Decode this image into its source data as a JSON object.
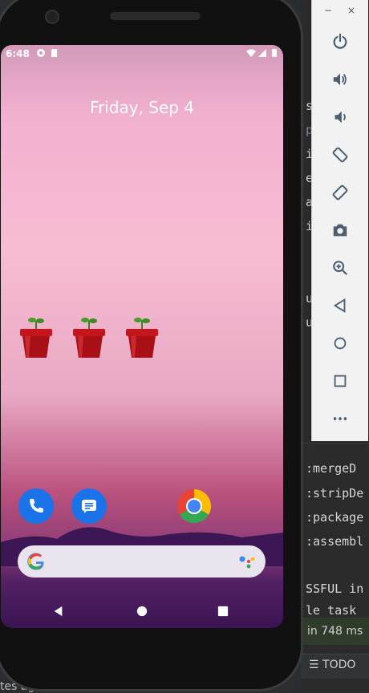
{
  "phone": {
    "status_bar": {
      "time": "6:48"
    },
    "date": "Friday, Sep 4",
    "home_icons": [
      {
        "name": "pot-plant-1"
      },
      {
        "name": "pot-plant-2"
      },
      {
        "name": "pot-plant-3"
      }
    ],
    "dock": [
      {
        "name": "phone-app",
        "color": "#1a73e8"
      },
      {
        "name": "messages-app",
        "color": "#1a73e8"
      },
      {
        "name": "chrome-app",
        "color": "#ea4335"
      }
    ]
  },
  "emulator_toolbar": {
    "minimize": "−",
    "close": "×",
    "buttons": [
      "power-icon",
      "volume-up-icon",
      "volume-down-icon",
      "rotate-left-icon",
      "rotate-right-icon",
      "camera-icon",
      "zoom-icon",
      "back-icon",
      "home-icon",
      "overview-icon",
      "more-icon"
    ]
  },
  "ide": {
    "code_lines": [
      "s",
      "p",
      "i",
      "e",
      "a",
      "i",
      "u",
      "u",
      ":mergeD",
      ":stripDe",
      ":package",
      ":assembl",
      "SSFUL in",
      "le task"
    ],
    "build_status": "in 748 ms",
    "todo_label": "TODO",
    "bottom_status": "tes ago)"
  },
  "colors": {
    "accent": "#1a73e8",
    "ide_bg": "#2b2b2b",
    "toolbar_bg": "#f2f2f2"
  }
}
